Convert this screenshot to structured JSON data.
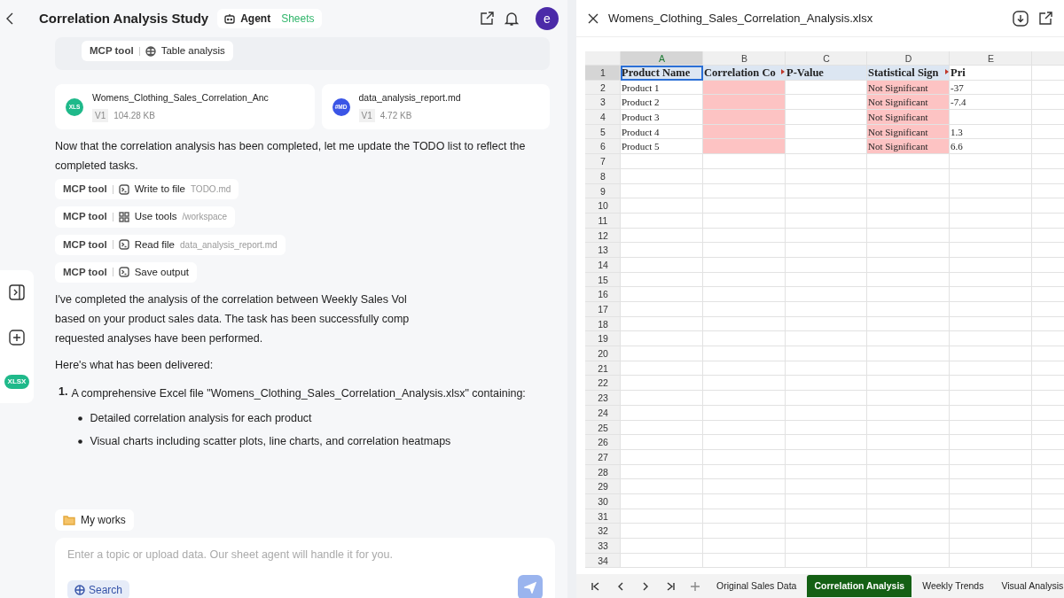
{
  "chat": {
    "title": "Correlation Analysis Study",
    "mode": {
      "agent": "Agent",
      "product": "Sheets"
    },
    "avatar": "e",
    "prior_tool": {
      "tool": "MCP tool",
      "kind": "table",
      "action": "Table analysis"
    },
    "files": [
      {
        "badge": "XLS",
        "kind": "xls",
        "name": "Womens_Clothing_Sales_Correlation_Anc",
        "version": "V1",
        "size": "104.28 KB"
      },
      {
        "badge": "#MD",
        "kind": "md",
        "name": "data_analysis_report.md",
        "version": "V1",
        "size": "4.72 KB"
      }
    ],
    "intro": "Now that the correlation analysis has been completed, let me update the TODO list to reflect the completed tasks.",
    "tools": [
      {
        "tool": "MCP tool",
        "kind": "terminal",
        "action": "Write to file",
        "detail": "TODO.md"
      },
      {
        "tool": "MCP tool",
        "kind": "grid",
        "action": "Use tools",
        "detail": "/workspace"
      },
      {
        "tool": "MCP tool",
        "kind": "terminal",
        "action": "Read file",
        "detail": "data_analysis_report.md"
      },
      {
        "tool": "MCP tool",
        "kind": "terminal",
        "action": "Save output"
      }
    ],
    "summary_lines": [
      "I've completed the analysis of the correlation between Weekly Sales Vol",
      "based on your product sales data. The task has been successfully comp",
      "requested analyses have been performed."
    ],
    "delivered": "Here's what has been delivered:",
    "list": [
      {
        "number": "1.",
        "text": "A comprehensive Excel file \"Womens_Clothing_Sales_Correlation_Analysis.xlsx\" containing:",
        "bullets": [
          "Detailed correlation analysis for each product",
          "Visual charts including scatter plots, line charts, and correlation heatmaps"
        ]
      }
    ],
    "my_works": "My works",
    "input": {
      "placeholder": "Enter a topic or upload data. Our sheet agent will handle it for you."
    },
    "search": "Search",
    "rail_badge": "XLSX"
  },
  "viewer": {
    "title": "Womens_Clothing_Sales_Correlation_Analysis.xlsx",
    "columns": [
      {
        "label": "A",
        "selected": true
      },
      {
        "label": "B",
        "selected": false
      },
      {
        "label": "C",
        "selected": false
      },
      {
        "label": "D",
        "selected": false
      },
      {
        "label": "E",
        "selected": false
      }
    ],
    "rows": [
      {
        "number": "1",
        "selected": true,
        "kind": "header",
        "cells": [
          {
            "text": "Product Name",
            "flagged": false,
            "selected": true
          },
          {
            "text": "Correlation Co",
            "flagged": false,
            "overflow": true
          },
          {
            "text": "P-Value",
            "flagged": false
          },
          {
            "text": "Statistical Sign",
            "flagged": false,
            "overflow": true
          },
          {
            "text": "Pri",
            "flagged": false
          }
        ]
      },
      {
        "number": "2",
        "selected": false,
        "cells": [
          {
            "text": "Product 1",
            "flagged": false
          },
          {
            "flagged": true
          },
          {
            "flagged": false
          },
          {
            "text": "Not Significant",
            "flagged": true
          },
          {
            "text": "-37",
            "flagged": false
          }
        ]
      },
      {
        "number": "3",
        "selected": false,
        "cells": [
          {
            "text": "Product 2",
            "flagged": false
          },
          {
            "flagged": true
          },
          {
            "flagged": false
          },
          {
            "text": "Not Significant",
            "flagged": true
          },
          {
            "text": "-7.4",
            "flagged": false
          }
        ]
      },
      {
        "number": "4",
        "selected": false,
        "cells": [
          {
            "text": "Product 3",
            "flagged": false
          },
          {
            "flagged": true
          },
          {
            "flagged": false
          },
          {
            "text": "Not Significant",
            "flagged": true
          },
          {
            "flagged": false
          }
        ]
      },
      {
        "number": "5",
        "selected": false,
        "cells": [
          {
            "text": "Product 4",
            "flagged": false
          },
          {
            "flagged": true
          },
          {
            "flagged": false
          },
          {
            "text": "Not Significant",
            "flagged": true
          },
          {
            "text": "1.3",
            "flagged": false
          }
        ]
      },
      {
        "number": "6",
        "selected": false,
        "cells": [
          {
            "text": "Product 5",
            "flagged": false
          },
          {
            "flagged": true
          },
          {
            "flagged": false
          },
          {
            "text": "Not Significant",
            "flagged": true
          },
          {
            "text": "6.6",
            "flagged": false
          }
        ]
      },
      {
        "number": "7",
        "selected": false
      },
      {
        "number": "8",
        "selected": false
      },
      {
        "number": "9",
        "selected": false
      },
      {
        "number": "10",
        "selected": false
      },
      {
        "number": "11",
        "selected": false
      },
      {
        "number": "12",
        "selected": false
      },
      {
        "number": "13",
        "selected": false
      },
      {
        "number": "14",
        "selected": false
      },
      {
        "number": "15",
        "selected": false
      },
      {
        "number": "16",
        "selected": false
      },
      {
        "number": "17",
        "selected": false
      },
      {
        "number": "18",
        "selected": false
      },
      {
        "number": "19",
        "selected": false
      },
      {
        "number": "20",
        "selected": false
      },
      {
        "number": "21",
        "selected": false
      },
      {
        "number": "22",
        "selected": false
      },
      {
        "number": "23",
        "selected": false
      },
      {
        "number": "24",
        "selected": false
      },
      {
        "number": "25",
        "selected": false
      },
      {
        "number": "26",
        "selected": false
      },
      {
        "number": "27",
        "selected": false
      },
      {
        "number": "28",
        "selected": false
      },
      {
        "number": "29",
        "selected": false
      },
      {
        "number": "30",
        "selected": false
      },
      {
        "number": "31",
        "selected": false
      },
      {
        "number": "32",
        "selected": false
      },
      {
        "number": "33",
        "selected": false
      },
      {
        "number": "34",
        "selected": false
      }
    ],
    "sheets": [
      {
        "label": "Original Sales Data",
        "selected": false
      },
      {
        "label": "Correlation Analysis",
        "selected": true
      },
      {
        "label": "Weekly Trends",
        "selected": false
      },
      {
        "label": "Visual Analysis",
        "selected": false
      }
    ]
  }
}
